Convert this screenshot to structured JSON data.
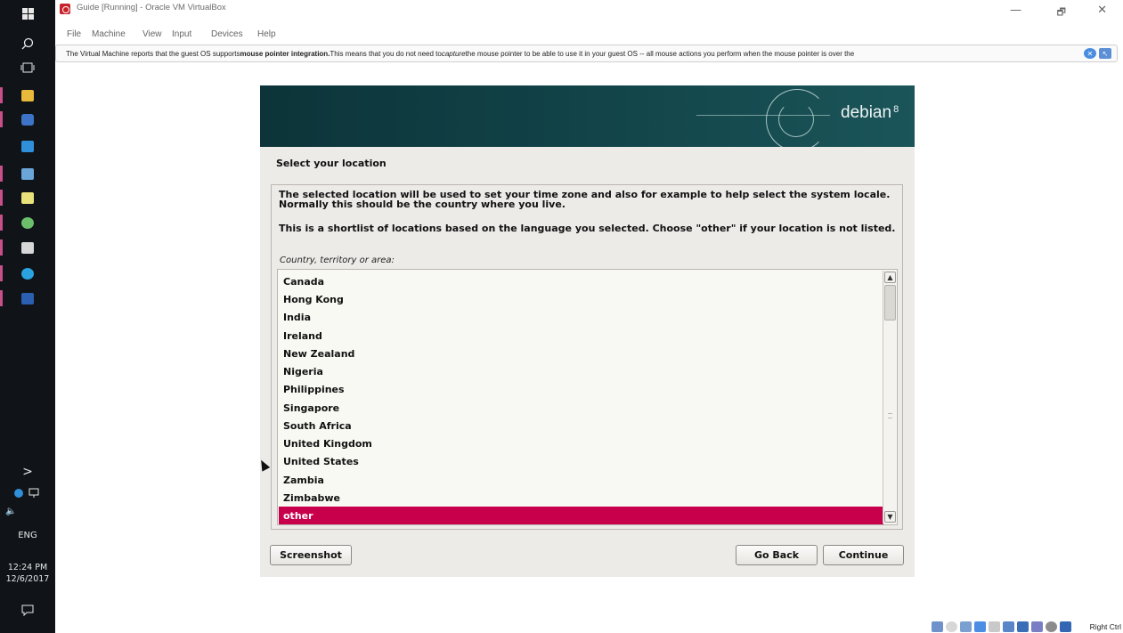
{
  "window": {
    "title": "Guide [Running] - Oracle VM VirtualBox",
    "menu": [
      "File",
      "Machine",
      "View",
      "Input",
      "Devices",
      "Help"
    ],
    "controls": {
      "minimize": "—",
      "restore": "🗗",
      "close": "✕"
    }
  },
  "notice": {
    "text_1": "The Virtual Machine reports that the guest OS supports ",
    "bold": "mouse pointer integration.",
    "text_2": " This means that you do not need to ",
    "italic": "capture",
    "text_3": " the mouse pointer to be able to use it in your guest OS -- all mouse actions you perform when the mouse pointer is over the"
  },
  "installer": {
    "brand": "debian",
    "brand_version": "8",
    "step_title": "Select your location",
    "paragraph_1": "The selected location will be used to set your time zone and also for example to help select the system locale. Normally this should be the country where you live.",
    "paragraph_2": "This is a shortlist of locations based on the language you selected. Choose \"other\" if your location is not listed.",
    "prompt": "Country, territory or area:",
    "options": [
      "Canada",
      "Hong Kong",
      "India",
      "Ireland",
      "New Zealand",
      "Nigeria",
      "Philippines",
      "Singapore",
      "South Africa",
      "United Kingdom",
      "United States",
      "Zambia",
      "Zimbabwe",
      "other"
    ],
    "selected_option": "other",
    "buttons": {
      "screenshot": "Screenshot",
      "go_back": "Go Back",
      "continue": "Continue"
    },
    "colors": {
      "banner": "#12454a",
      "selection": "#c8004c",
      "background": "#edebe8"
    }
  },
  "taskbar": {
    "icons": [
      "windows-start-icon",
      "search-icon",
      "task-view-icon",
      "file-explorer-icon",
      "virtualbox-icon",
      "remote-desktop-icon",
      "network-folder-icon",
      "notepad-icon",
      "paint-icon",
      "app-window-icon",
      "telegram-icon",
      "word-icon"
    ],
    "tray_expand": ">",
    "language": "ENG",
    "time": "12:24 PM",
    "date": "12/6/2017"
  },
  "statusbar": {
    "host_key": "Right Ctrl"
  }
}
